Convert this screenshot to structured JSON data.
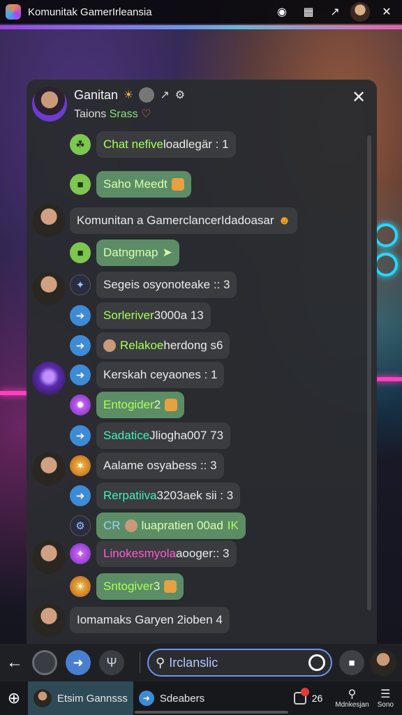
{
  "window": {
    "title": "Komunitak GamerIrleansia",
    "icons": [
      "headset-icon",
      "calendar-icon",
      "share-icon",
      "profile-avatar",
      "close-icon"
    ]
  },
  "chat": {
    "header": {
      "name": "Ganitan",
      "subtitle_label": "Taions",
      "subtitle_value": "Srass"
    },
    "messages": [
      {
        "text": "Chat nefive",
        "suffix": " loadlegär : 1",
        "icon": "leaf-icon",
        "style": "grey"
      },
      {
        "text": "Saho Meedt",
        "suffix": "",
        "icon": "card-icon",
        "style": "green"
      },
      {
        "text": "Komunitan a GamerclancerIdadoasar",
        "suffix": "",
        "icon": "",
        "style": "grey"
      },
      {
        "text": "Datngmap",
        "suffix": "",
        "icon": "card-icon",
        "style": "green"
      },
      {
        "text": "Segeis osyonoteake :: 3",
        "suffix": "",
        "icon": "spark-icon",
        "style": "grey"
      },
      {
        "text": "Sorleriver",
        "suffix": " 3000a 13",
        "icon": "bolt-icon",
        "style": "grey"
      },
      {
        "text": "Relakoe",
        "suffix": " herdong s6",
        "icon": "bolt-icon",
        "style": "grey"
      },
      {
        "text": "Kerskah ceyaones : 1",
        "suffix": "",
        "icon": "bolt-icon",
        "style": "grey"
      },
      {
        "text": "Entogider",
        "suffix": " 2",
        "icon": "star-burst-icon",
        "style": "green"
      },
      {
        "text": "Sadatice",
        "suffix": " Jliogha007 73",
        "icon": "bolt-icon",
        "style": "grey"
      },
      {
        "text": "Aalame osyabess :: 3",
        "suffix": "",
        "icon": "badge-icon",
        "style": "grey"
      },
      {
        "text": "Rerpatiiva",
        "suffix": " 3203aek sii : 3",
        "icon": "bolt-icon",
        "style": "grey"
      },
      {
        "text": "CR",
        "suffix": " luapratien 00ad",
        "tag": "IK",
        "icon": "gear-icon",
        "style": "green"
      },
      {
        "text": "Linokesmyola",
        "suffix": " aooger:: 3",
        "icon": "spark-icon",
        "style": "grey"
      },
      {
        "text": "Sntogiver",
        "suffix": " 3",
        "icon": "sun-icon",
        "style": "green"
      },
      {
        "text": "Iomamaks Garyen 2ioben 4",
        "suffix": "",
        "icon": "",
        "style": "grey"
      }
    ]
  },
  "input": {
    "search_value": "Irclanslic"
  },
  "taskbar": {
    "tab1": "Etsim Gannsss",
    "tab2": "Sdeabers",
    "notif_count": "26",
    "item1": "Mdnkesjan",
    "item2": "Sono"
  },
  "colors": {
    "panel": "#2a2c30",
    "green_bubble": "#5d8d66",
    "accent_green": "#a8ff5a",
    "accent_teal": "#43f0b8",
    "accent_pink": "#ff5ad8",
    "search_border": "#6d93f0"
  }
}
